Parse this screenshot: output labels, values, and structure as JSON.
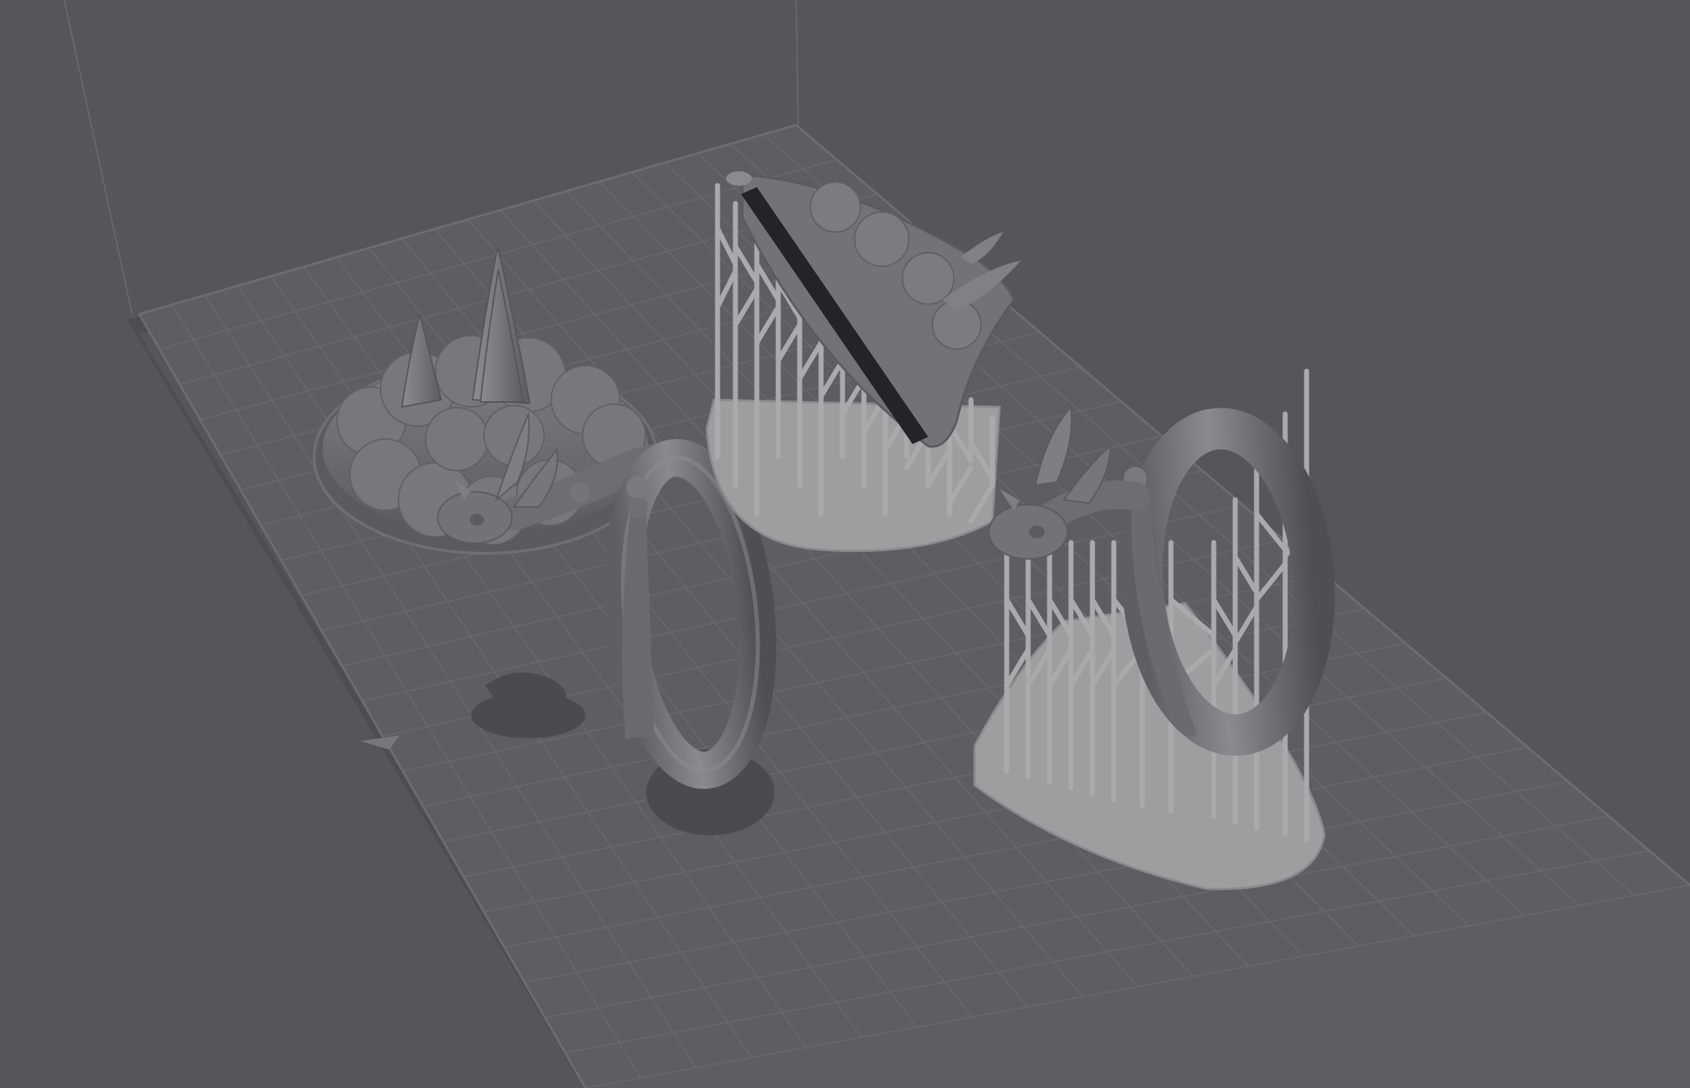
{
  "viewport": {
    "background_color": "#55565b",
    "plate_color": "#5d5e63",
    "grid_color": "#6c6d72",
    "model_color": "#707174",
    "support_color": "#a9aaab",
    "raft_color": "#9d9e9f"
  },
  "scene": {
    "models": [
      {
        "name": "cloud-base-model",
        "supports": false
      },
      {
        "name": "dragon-ring-model",
        "supports": false
      },
      {
        "name": "cloud-base-model-supported",
        "supports": true
      },
      {
        "name": "dragon-ring-model-supported",
        "supports": true
      }
    ]
  }
}
